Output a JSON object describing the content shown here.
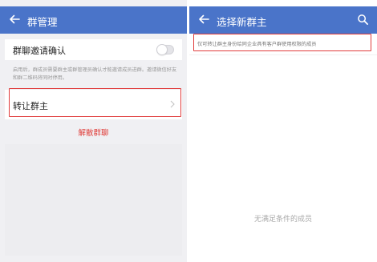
{
  "left_screen": {
    "header": {
      "title": "群管理"
    },
    "invite_confirm": {
      "label": "群聊邀请确认",
      "enabled": false
    },
    "description": "启用后，群成员需要群主或群管理员确认才能邀请成员进群。邀请微信好友和群二维码将同时停用。",
    "transfer": {
      "label": "转让群主"
    },
    "dissolve": {
      "label": "解散群聊"
    }
  },
  "right_screen": {
    "header": {
      "title": "选择新群主"
    },
    "hint": "仅可转让群主身份给同企业具有客户群使用权限的成员",
    "empty_state": "无满足条件的成员"
  },
  "colors": {
    "header_bg": "#4a74c9",
    "annotation_red": "#e03c3c",
    "danger_text": "#e0413d"
  },
  "icons": [
    "back-arrow-icon",
    "search-icon",
    "chevron-right-icon"
  ]
}
